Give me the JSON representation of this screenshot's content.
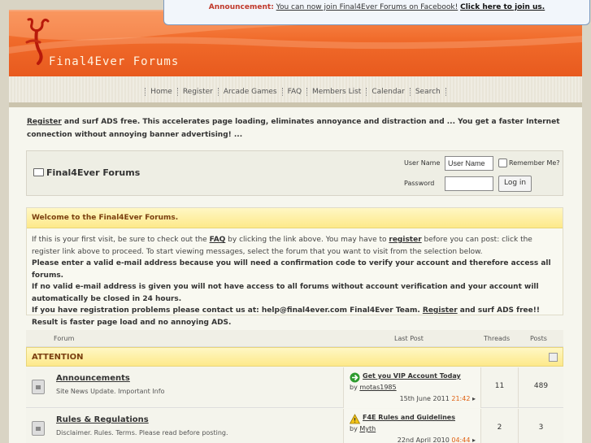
{
  "announcement": {
    "label": "Announcement:",
    "message": "You can now join Final4Ever Forums on Facebook!",
    "link": "Click here to join us."
  },
  "header": {
    "logo_text": "Final4Ever Forums",
    "colors": {
      "brand": "#f06a2a",
      "accent_title": "#7a3f10",
      "time": "#e06010"
    }
  },
  "navbar": {
    "items": [
      "Home",
      "Register",
      "Arcade Games",
      "FAQ",
      "Members List",
      "Calendar",
      "Search"
    ]
  },
  "promo": {
    "register_link": "Register",
    "text": " and surf ADS free. This accelerates page loading, eliminates annoyance and distraction and ... You get a faster Internet connection without annoying banner advertising! ..."
  },
  "login": {
    "forum_title": "Final4Ever Forums",
    "username_label": "User Name",
    "username_value": "User Name",
    "remember_label": "Remember Me?",
    "password_label": "Password",
    "login_button": "Log in"
  },
  "welcome": {
    "title": "Welcome to the Final4Ever Forums.",
    "p1_a": "If this is your first visit, be sure to check out the ",
    "faq": "FAQ",
    "p1_b": " by clicking the link above. You may have to ",
    "register": "register",
    "p1_c": " before you can post: click the register link above to proceed. To start viewing messages, select the forum that you want to visit from the selection below.",
    "b1": "Please enter a valid e-mail address because you will need a confirmation code to verify your account and therefore access all forums.",
    "b2": "If no valid e-mail address is given you will not have access to all forums without account verification and your account will automatically be closed in 24 hours.",
    "b3_a": "If you have registration problems please contact us at: help@final4ever.com Final4Ever Team. ",
    "b3_reg": "Register",
    "b3_b": " and surf ADS free!! Result is faster page load and no annoying ADS."
  },
  "forum_table": {
    "columns": {
      "forum": "Forum",
      "last_post": "Last Post",
      "threads": "Threads",
      "posts": "Posts"
    },
    "category": "ATTENTION",
    "rows": [
      {
        "title": "Announcements",
        "description": "Site News Update. Important Info",
        "last_post_title": "Get you VIP Account Today",
        "by": "by ",
        "last_post_user": "motas1985",
        "last_post_date": "15th June 2011 ",
        "last_post_time": "21:42",
        "threads": "11",
        "posts": "489",
        "icon": "green-arrow-icon"
      },
      {
        "title": "Rules & Regulations",
        "description": "Disclaimer. Rules. Terms. Please read before posting.",
        "last_post_title": "F4E Rules and Guidelines",
        "by": "by ",
        "last_post_user": "Myth",
        "last_post_date": "22nd April 2010 ",
        "last_post_time": "04:44",
        "threads": "2",
        "posts": "3",
        "icon": "warning-icon"
      }
    ]
  }
}
